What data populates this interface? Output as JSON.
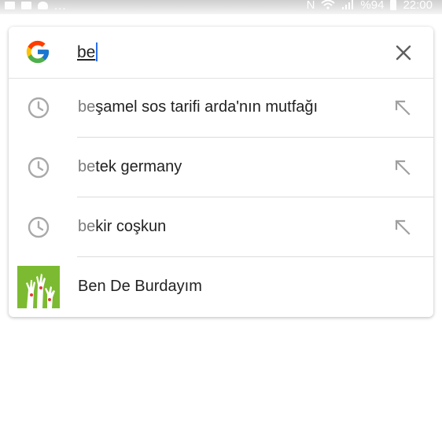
{
  "status_bar": {
    "left_icons": [
      "image-icon",
      "note-icon",
      "cloud-icon"
    ],
    "more": "...",
    "nfc": "N",
    "battery_percent": "%94",
    "time": "22:00"
  },
  "search": {
    "query_typed": "be",
    "clear_icon": "close-icon"
  },
  "suggestions": [
    {
      "prefix": "be",
      "rest": "şamel sos tarifi arda'nın mutfağı",
      "icon": "clock-icon",
      "action_icon": "arrow-up-left-icon"
    },
    {
      "prefix": "be",
      "rest": "tek germany",
      "icon": "clock-icon",
      "action_icon": "arrow-up-left-icon"
    },
    {
      "prefix": "be",
      "rest": "kir coşkun",
      "icon": "clock-icon",
      "action_icon": "arrow-up-left-icon"
    }
  ],
  "app_result": {
    "label": "Ben De Burdayım",
    "icon": "raised-hands-logo",
    "thumb_color": "#7cbb31"
  },
  "colors": {
    "card_background": "#ffffff",
    "cursor": "#2a6ff0",
    "icon_gray": "#a9a9a9"
  }
}
